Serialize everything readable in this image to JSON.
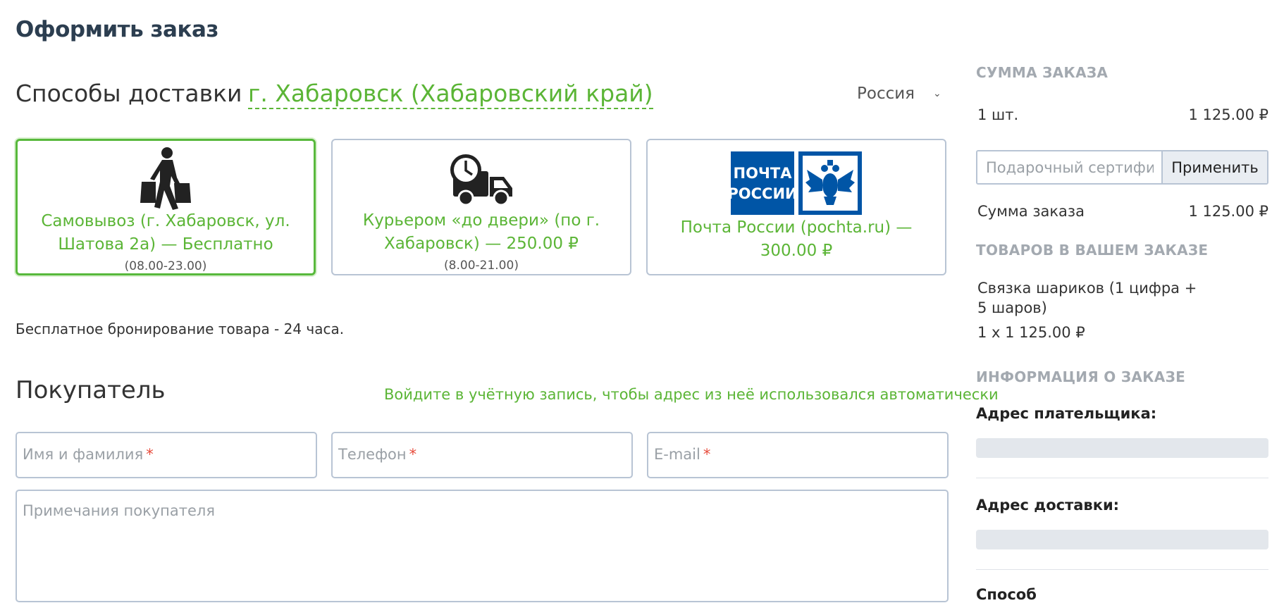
{
  "page": {
    "title": "Оформить заказ"
  },
  "delivery": {
    "heading": "Способы доставки",
    "city": "г. Хабаровск (Хабаровский край)",
    "country": "Россия",
    "options": [
      {
        "title": "Самовывоз (г. Хабаровск, ул. Шатова 2а) — Бесплатно",
        "hours": "(08.00-23.00)",
        "icon": "pickup-person-icon",
        "selected": true
      },
      {
        "title": "Курьером «до двери» (по г. Хабаровск) — 250.00 ₽",
        "hours": "(8.00-21.00)",
        "icon": "courier-truck-icon",
        "selected": false
      },
      {
        "title": "Почта России (pochta.ru) — 300.00 ₽",
        "logo_text": [
          "ПОЧТА",
          "РОССИИ"
        ],
        "icon": "russian-post-logo",
        "selected": false
      }
    ],
    "note": "Бесплатное бронирование товара - 24 часа."
  },
  "buyer": {
    "heading": "Покупатель",
    "login_link": "Войдите в учётную запись, чтобы адрес из неё использовался автоматически",
    "fields": {
      "name_placeholder": "Имя и фамилия",
      "phone_placeholder": "Телефон",
      "email_placeholder": "E-mail",
      "required_mark": "*",
      "notes_placeholder": "Примечания покупателя"
    }
  },
  "sidebar": {
    "sum_heading": "СУММА ЗАКАЗА",
    "qty_label": "1 шт.",
    "qty_value": "1 125.00 ₽",
    "certificate_placeholder": "Подарочный сертификат",
    "apply_label": "Применить",
    "total_label": "Сумма заказа",
    "total_value": "1 125.00 ₽",
    "items_heading": "ТОВАРОВ В ВАШЕМ ЗАКАЗЕ",
    "item_name": "Связка шариков (1 цифра + 5 шаров)",
    "item_qty": "1 x 1 125.00 ₽",
    "info_heading": "ИНФОРМАЦИЯ О ЗАКАЗЕ",
    "payer_address_label": "Адрес плательщика:",
    "delivery_address_label": "Адрес доставки:",
    "cut_label": "Способ"
  },
  "colors": {
    "accent": "#5bb536",
    "border": "#b8c4d4",
    "required": "#e74c3c"
  }
}
